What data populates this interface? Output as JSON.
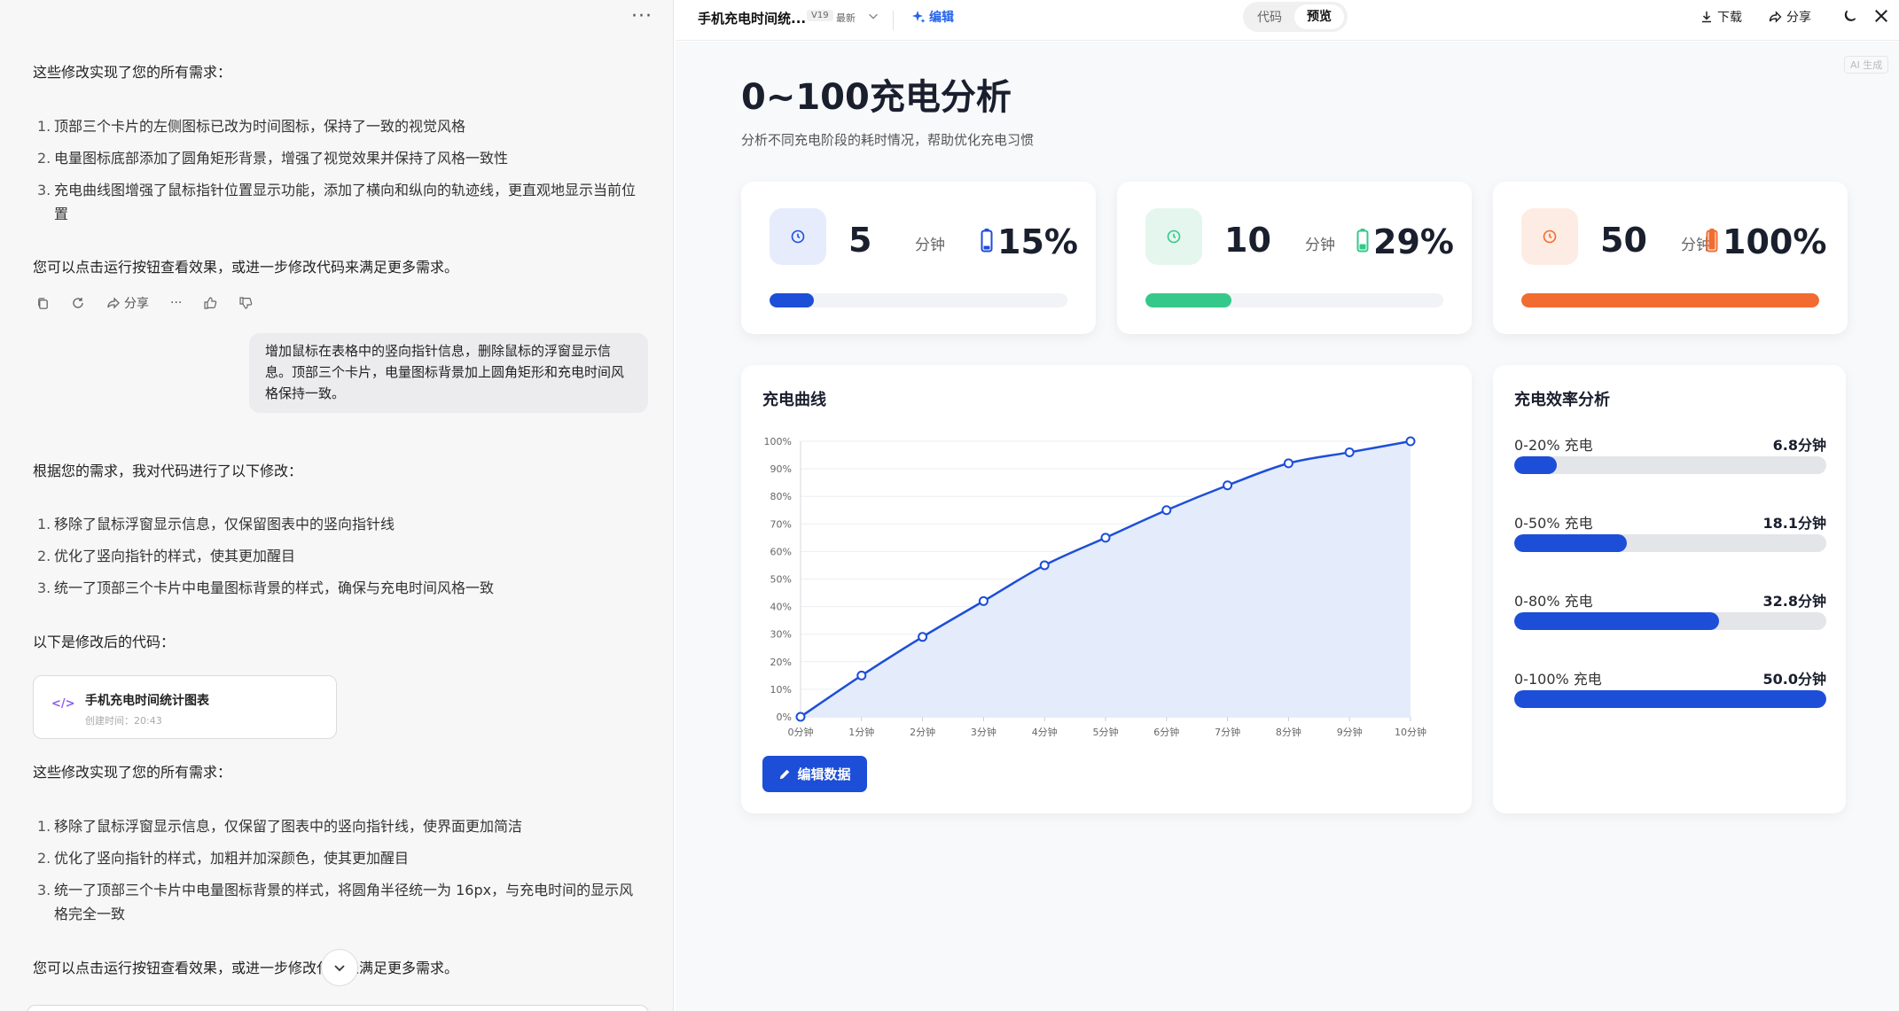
{
  "chat": {
    "more_label": "···",
    "intro1": "这些修改实现了您的所有需求：",
    "list1": [
      {
        "n": "1.",
        "t": "顶部三个卡片的左侧图标已改为时间图标，保持了一致的视觉风格"
      },
      {
        "n": "2.",
        "t": "电量图标底部添加了圆角矩形背景，增强了视觉效果并保持了风格一致性"
      },
      {
        "n": "3.",
        "t": "充电曲线图增强了鼠标指针位置显示功能，添加了横向和纵向的轨迹线，更直观地显示当前位置"
      }
    ],
    "outro1": "您可以点击运行按钮查看效果，或进一步修改代码来满足更多需求。",
    "share_label": "分享",
    "user_message": "增加鼠标在表格中的竖向指针信息，删除鼠标的浮窗显示信息。顶部三个卡片，电量图标背景加上圆角矩形和充电时间风格保持一致。",
    "intro2": "根据您的需求，我对代码进行了以下修改：",
    "list2": [
      {
        "n": "1.",
        "t": "移除了鼠标浮窗显示信息，仅保留图表中的竖向指针线"
      },
      {
        "n": "2.",
        "t": "优化了竖向指针的样式，使其更加醒目"
      },
      {
        "n": "3.",
        "t": "统一了顶部三个卡片中电量图标背景的样式，确保与充电时间风格一致"
      }
    ],
    "code_intro": "以下是修改后的代码：",
    "code_card": {
      "title": "手机充电时间统计图表",
      "created": "创建时间：20:43",
      "icon": "</>"
    },
    "intro3": "这些修改实现了您的所有需求：",
    "list3": [
      {
        "n": "1.",
        "t": "移除了鼠标浮窗显示信息，仅保留了图表中的竖向指针线，使界面更加简洁"
      },
      {
        "n": "2.",
        "t": "优化了竖向指针的样式，加粗并加深颜色，使其更加醒目"
      },
      {
        "n": "3.",
        "t": "统一了顶部三个卡片中电量图标背景的样式，将圆角半径统一为 16px，与充电时间的显示风格完全一致"
      }
    ],
    "outro2": "您可以点击运行按钮查看效果，或进一步修改代码来满足更多需求。"
  },
  "topbar": {
    "title": "手机充电时间统...",
    "version": "V19",
    "latest": "最新",
    "edit": "编辑",
    "tab_code": "代码",
    "tab_preview": "预览",
    "download": "下载",
    "share": "分享"
  },
  "preview": {
    "ai_tag": "AI 生成",
    "title": "0~100充电分析",
    "subtitle": "分析不同充电阶段的耗时情况，帮助优化充电习惯",
    "cards": [
      {
        "value": "5",
        "unit": "分钟",
        "percent": "15%",
        "color": "#1d4ed8",
        "bg": "#e6ecfb",
        "fill": 0.15
      },
      {
        "value": "10",
        "unit": "分钟",
        "percent": "29%",
        "color": "#34c98b",
        "bg": "#e4f6ee",
        "fill": 0.29
      },
      {
        "value": "50",
        "unit": "分钟",
        "percent": "100%",
        "color": "#f26b30",
        "bg": "#fdece3",
        "fill": 1.0
      }
    ],
    "chart_title": "充电曲线",
    "edit_data": "编辑数据",
    "efficiency": {
      "title": "充电效率分析",
      "rows": [
        {
          "label": "0-20% 充电",
          "time": "6.8分钟",
          "fill": 0.136
        },
        {
          "label": "0-50% 充电",
          "time": "18.1分钟",
          "fill": 0.362
        },
        {
          "label": "0-80% 充电",
          "time": "32.8分钟",
          "fill": 0.656
        },
        {
          "label": "0-100% 充电",
          "time": "50.0分钟",
          "fill": 1.0
        }
      ]
    }
  },
  "chart_data": {
    "type": "line",
    "x": [
      "0分钟",
      "1分钟",
      "2分钟",
      "3分钟",
      "4分钟",
      "5分钟",
      "6分钟",
      "7分钟",
      "8分钟",
      "9分钟",
      "10分钟"
    ],
    "values": [
      0,
      15,
      29,
      42,
      55,
      65,
      75,
      84,
      92,
      96,
      100
    ],
    "yticks": [
      "0%",
      "10%",
      "20%",
      "30%",
      "40%",
      "50%",
      "60%",
      "70%",
      "80%",
      "90%",
      "100%"
    ],
    "ylim": [
      0,
      100
    ],
    "color": "#1d4ed8",
    "fill_color": "#e3ebfc",
    "grid": true
  }
}
